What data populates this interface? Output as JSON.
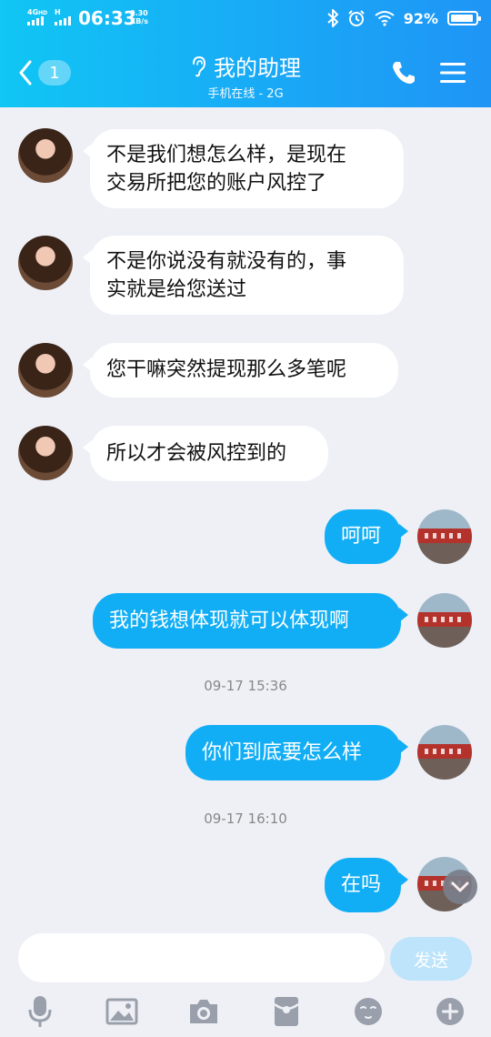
{
  "status_bar": {
    "network_tag_1": "4G",
    "network_tag_1_sup": "HD",
    "network_tag_2": "H",
    "time": "06:33",
    "speed_value": "0.30",
    "speed_unit": "KB/s",
    "battery_percent": "92%",
    "battery_level": 0.92
  },
  "header": {
    "unread_count": "1",
    "title": "我的助理",
    "subtitle": "手机在线 - 2G"
  },
  "messages": [
    {
      "from": "contact",
      "lines": [
        "不是我们想怎么样，是现在",
        "交易所把您的账户风控了"
      ]
    },
    {
      "from": "contact",
      "lines": [
        "不是你说没有就没有的，事",
        "实就是给您送过"
      ]
    },
    {
      "from": "contact",
      "lines": [
        "您干嘛突然提现那么多笔呢"
      ]
    },
    {
      "from": "contact",
      "lines": [
        "所以才会被风控到的"
      ]
    },
    {
      "from": "me",
      "lines": [
        "呵呵"
      ]
    },
    {
      "from": "me",
      "lines": [
        "我的钱想体现就可以体现啊"
      ]
    },
    {
      "timestamp": "09-17 15:36"
    },
    {
      "from": "me",
      "lines": [
        "你们到底要怎么样"
      ]
    },
    {
      "timestamp": "09-17 16:10"
    },
    {
      "from": "me",
      "lines": [
        "在吗"
      ]
    }
  ],
  "composer": {
    "input_value": "",
    "send_label": "发送"
  },
  "toolbar": {
    "icons": [
      "microphone-icon",
      "image-icon",
      "camera-icon",
      "red-packet-icon",
      "emoji-icon",
      "plus-icon"
    ]
  },
  "colors": {
    "header_start": "#10c6f4",
    "header_end": "#1f95f6",
    "outgoing_bubble": "#12aef5",
    "incoming_bubble": "#ffffff",
    "background": "#eef0f6",
    "send_button": "#bde4fb"
  }
}
